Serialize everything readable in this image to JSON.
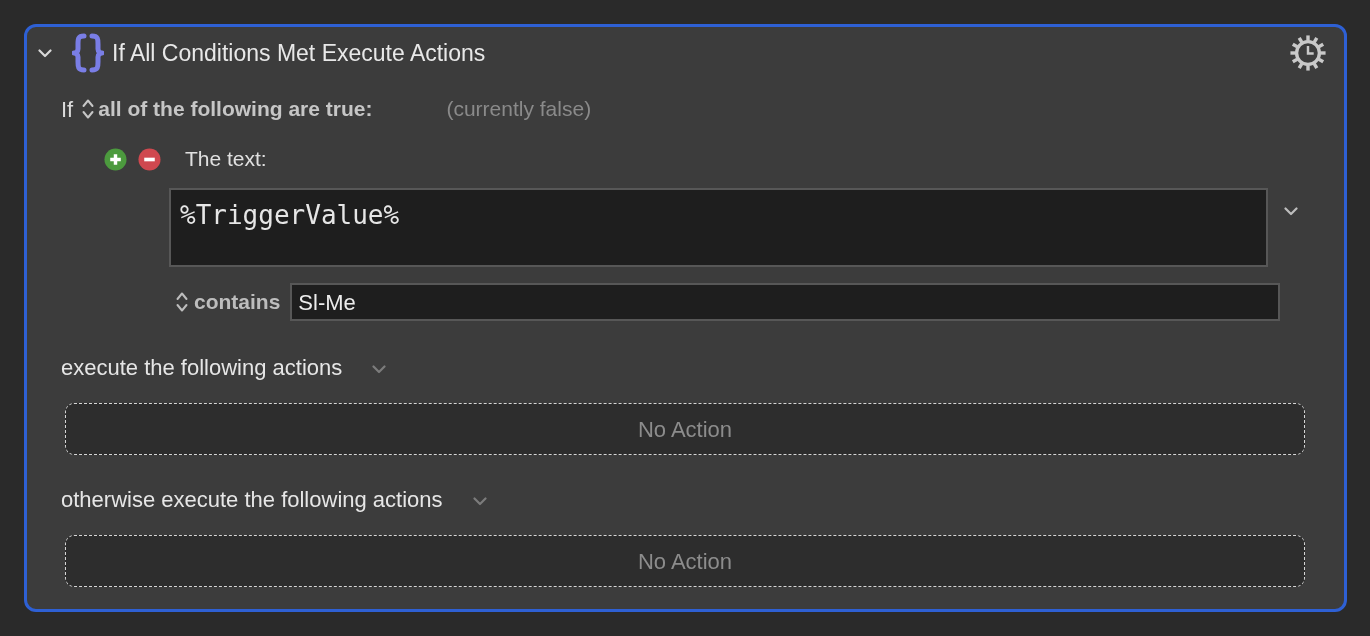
{
  "block": {
    "expanded": true,
    "title": "If All Conditions Met Execute Actions"
  },
  "condition": {
    "prefix": "If",
    "mode": "all of the following are true:",
    "status": "(currently false)"
  },
  "conditions": [
    {
      "label": "The text:",
      "source": "%TriggerValue%",
      "operator": "contains",
      "value": "Sl-Me"
    }
  ],
  "branches": [
    {
      "label": "execute the following actions",
      "empty_text": "No Action"
    },
    {
      "label": "otherwise execute the following actions",
      "empty_text": "No Action"
    }
  ]
}
